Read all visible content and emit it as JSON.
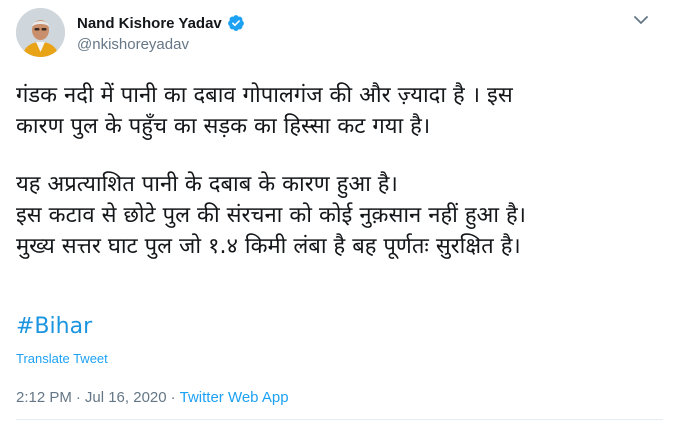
{
  "author": {
    "name": "Nand Kishore Yadav",
    "handle": "@nkishoreyadav"
  },
  "tweet": {
    "lines": [
      "गंडक नदी में पानी का दबाव गोपालगंज की और ज़्यादा है । इस",
      "कारण पुल के पहुँच का सड़क का हिस्सा कट गया है।",
      "यह अप्रत्याशित पानी के दबाब के कारण हुआ है।",
      "इस कटाव से छोटे पुल की संरचना को कोई नुक़सान नहीं हुआ है।",
      "मुख्य सत्तर घाट पुल जो १.४ किमी लंबा है बह पूर्णतः सुरक्षित है।"
    ],
    "hashtag": "#Bihar",
    "translate_label": "Translate Tweet",
    "time": "2:12 PM",
    "separator": "·",
    "date": "Jul 16, 2020",
    "source": "Twitter Web App"
  },
  "icons": {
    "verified": "verified-badge-icon",
    "menu": "chevron-down-icon"
  },
  "colors": {
    "link": "#1b95e0",
    "accent": "#1da1f2",
    "muted": "#657786",
    "text": "#14171a"
  }
}
